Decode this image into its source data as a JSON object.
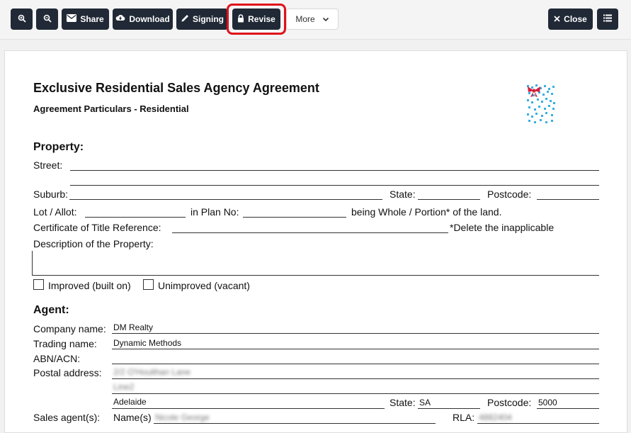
{
  "toolbar": {
    "share_label": "Share",
    "download_label": "Download",
    "signing_label": "Signing",
    "revise_label": "Revise",
    "more_label": "More",
    "close_label": "Close"
  },
  "doc": {
    "title": "Exclusive Residential Sales Agency Agreement",
    "subtitle": "Agreement Particulars - Residential",
    "property": {
      "heading": "Property:",
      "street_label": "Street:",
      "suburb_label": "Suburb:",
      "state_label": "State:",
      "postcode_label": "Postcode:",
      "lot_label": "Lot / Allot:",
      "plan_label": "in Plan No:",
      "whole_label": "being Whole / Portion* of the land.",
      "ct_label": "Certificate of Title Reference:",
      "delete_note": "*Delete the inapplicable",
      "desc_label": "Description of the Property:",
      "improved_label": "Improved (built on)",
      "unimproved_label": "Unimproved (vacant)"
    },
    "agent": {
      "heading": "Agent:",
      "company_label": "Company name:",
      "company_value": "DM Realty",
      "trading_label": "Trading name:",
      "trading_value": "Dynamic Methods",
      "abn_label": "ABN/ACN:",
      "postal_label": "Postal address:",
      "postal_line1": "2/2 O'Houlihan Lane",
      "postal_line2": "Line2",
      "postal_city": "Adelaide",
      "state_label": "State:",
      "state_value": "SA",
      "postcode_label": "Postcode:",
      "postcode_value": "5000",
      "sales_agents_label": "Sales agent(s):",
      "names_label": "Name(s)",
      "names_value": "Nicole George",
      "rla_label": "RLA:",
      "rla_value": "4882404"
    }
  }
}
